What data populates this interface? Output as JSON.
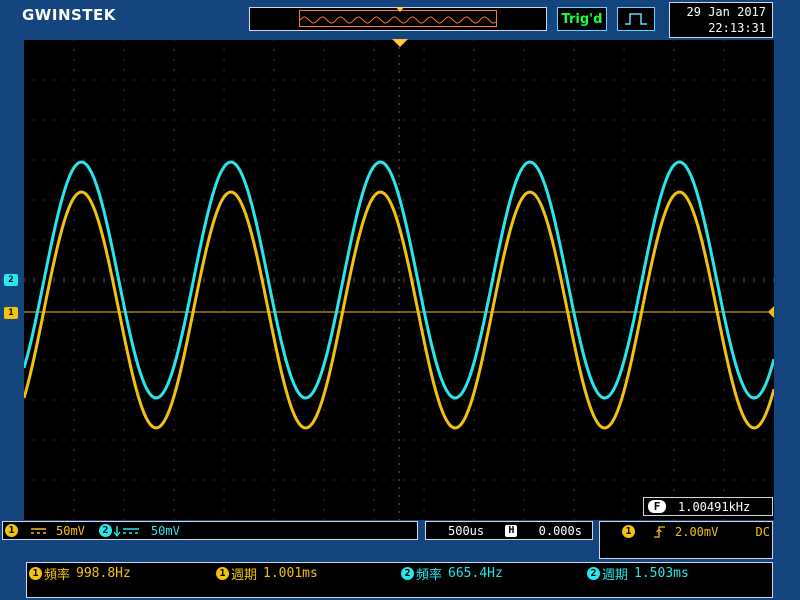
{
  "header": {
    "brand": "GWINSTEK",
    "trigger_status": "Trig'd",
    "trigger_mode_icon": "pulse-wave-icon",
    "date": "29 Jan 2017",
    "time": "22:13:31"
  },
  "screen": {
    "channel_marker_1": "1",
    "channel_marker_2": "2",
    "frequency_counter_icon": "F",
    "frequency_counter": "1.00491kHz"
  },
  "status": {
    "ch1": {
      "chip": "1",
      "coupling_icon": "dc-coupling-icon",
      "scale": "50mV"
    },
    "ch2": {
      "chip": "2",
      "coupling_icon": "invert-dc-coupling-icon",
      "scale": "50mV"
    },
    "timebase": "500us",
    "horizontal_icon": "H",
    "position": "0.000s",
    "trigger": {
      "chip": "1",
      "slope_icon": "rising-edge-icon",
      "level": "2.00mV",
      "coupling": "DC"
    }
  },
  "measurements": [
    {
      "chip": "1",
      "label": "頻率",
      "value": "998.8Hz"
    },
    {
      "chip": "1",
      "label": "週期",
      "value": "1.001ms"
    },
    {
      "chip": "2",
      "label": "頻率",
      "value": "665.4Hz"
    },
    {
      "chip": "2",
      "label": "週期",
      "value": "1.503ms"
    }
  ],
  "colors": {
    "background": "#14457f",
    "ch1": "#f2c20f",
    "ch2": "#27e6ec",
    "trigger_ok": "#19ff3b",
    "overview_window": "#ff7a2a"
  }
}
